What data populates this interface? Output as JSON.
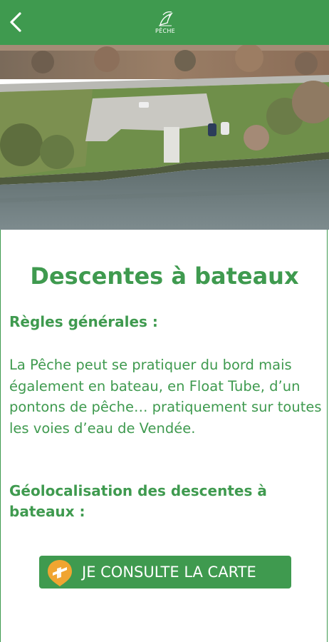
{
  "header": {
    "back_icon": "chevron-left-icon",
    "logo_text": "PÊCHE",
    "logo_icon": "fish-logo-icon",
    "color": "#3f9a4f"
  },
  "hero": {
    "icon": "aerial-lake-photo"
  },
  "content": {
    "title": "Descentes à bateaux",
    "rules_heading": "Règles générales :",
    "rules_text": "La Pêche peut se pratiquer du bord mais également en bateau, en Float Tube, d’un pontons de pêche… pratiquement sur toutes les voies d’eau de Vendée.",
    "geo_heading": "Géolocalisation des descentes à bateaux :"
  },
  "cta": {
    "label": "JE CONSULTE LA CARTE",
    "icon": "map-pin-icon",
    "icon_color": "#f0a531"
  }
}
